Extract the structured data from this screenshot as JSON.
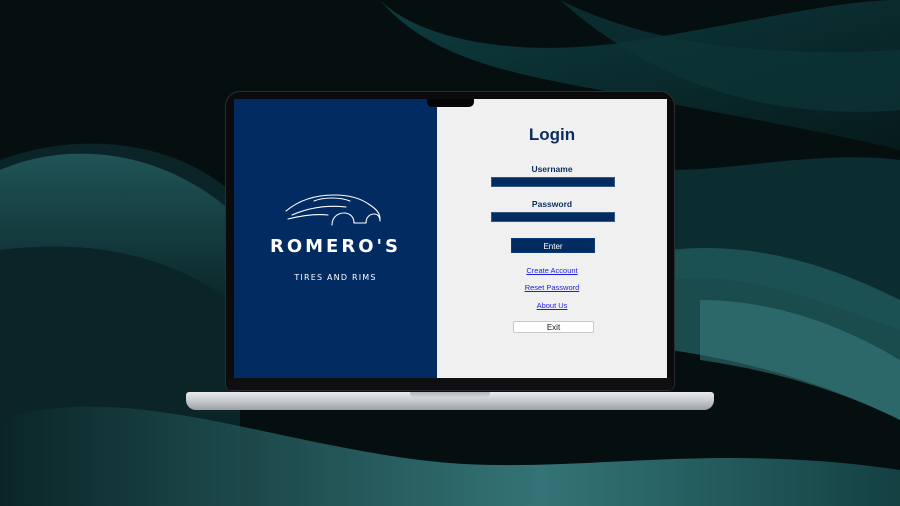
{
  "brand": {
    "name": "ROMERO'S",
    "tagline": "TIRES AND RIMS"
  },
  "login": {
    "title": "Login",
    "username_label": "Username",
    "username_value": "",
    "password_label": "Password",
    "password_value": "",
    "enter_label": "Enter",
    "create_account_label": "Create Account",
    "reset_password_label": "Reset Password",
    "about_us_label": "About Us",
    "exit_label": "Exit"
  },
  "colors": {
    "brand_blue": "#012b61",
    "panel_gray": "#f0f0f1",
    "link_blue": "#1d1de0"
  },
  "icons": {
    "logo": "car-outline-icon"
  }
}
